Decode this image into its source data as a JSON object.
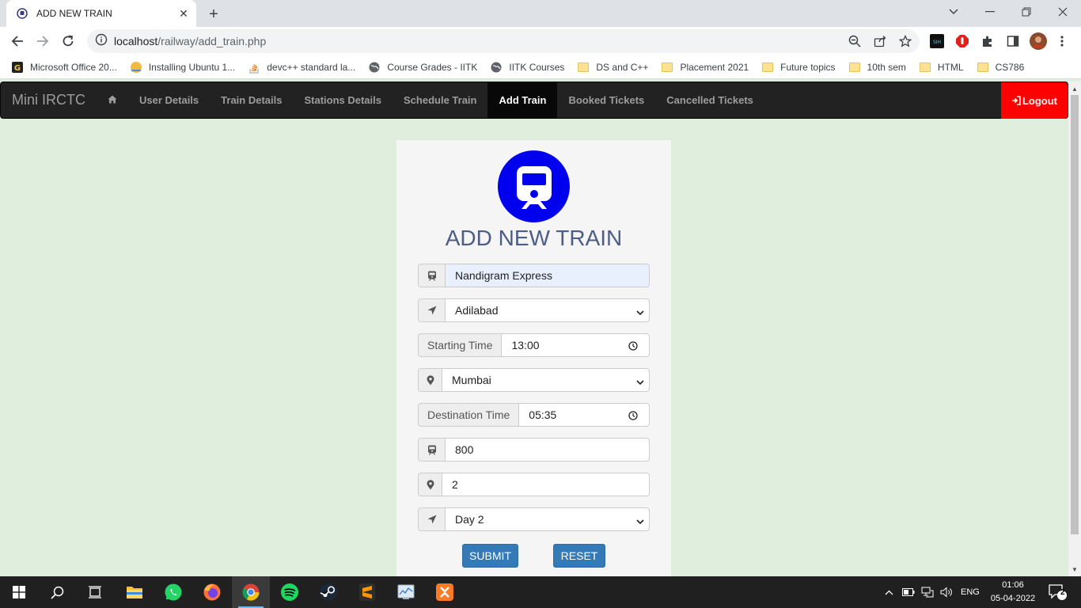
{
  "browser": {
    "tab_title": "ADD NEW TRAIN",
    "url_host": "localhost",
    "url_path": "/railway/add_train.php",
    "bookmarks": [
      {
        "label": "Microsoft Office 20...",
        "icon": "grammarly-icon"
      },
      {
        "label": "Installing Ubuntu 1...",
        "icon": "ubuntu-icon"
      },
      {
        "label": "devc++ standard la...",
        "icon": "stackoverflow-icon"
      },
      {
        "label": "Course Grades - IITK",
        "icon": "globe-icon"
      },
      {
        "label": "IITK Courses",
        "icon": "globe-icon"
      },
      {
        "label": "DS and C++",
        "icon": "folder-icon"
      },
      {
        "label": "Placement 2021",
        "icon": "folder-icon"
      },
      {
        "label": "Future topics",
        "icon": "folder-icon"
      },
      {
        "label": "10th sem",
        "icon": "folder-icon"
      },
      {
        "label": "HTML",
        "icon": "folder-icon"
      },
      {
        "label": "CS786",
        "icon": "folder-icon"
      }
    ]
  },
  "nav": {
    "brand": "Mini IRCTC",
    "items": [
      "User Details",
      "Train Details",
      "Stations Details",
      "Schedule Train",
      "Add Train",
      "Booked Tickets",
      "Cancelled Tickets"
    ],
    "active": "Add Train",
    "logout": "Logout"
  },
  "form": {
    "title": "ADD NEW TRAIN",
    "train_name": "Nandigram Express",
    "source": "Adilabad",
    "starting_time_label": "Starting Time",
    "starting_time": "13:00",
    "destination": "Mumbai",
    "destination_time_label": "Destination Time",
    "destination_time": "05:35",
    "distance": "800",
    "stops": "2",
    "day": "Day 2",
    "submit": "SUBMIT",
    "reset": "RESET"
  },
  "taskbar": {
    "language": "ENG",
    "time": "01:06",
    "date": "05-04-2022",
    "notifications": "2"
  },
  "colors": {
    "page_bg": "#dfeedd",
    "navbar_bg": "#222222",
    "logout_bg": "#ff0000",
    "logo_bg": "#0000ee",
    "button_bg": "#337ab7",
    "title_color": "#4d5d87"
  }
}
